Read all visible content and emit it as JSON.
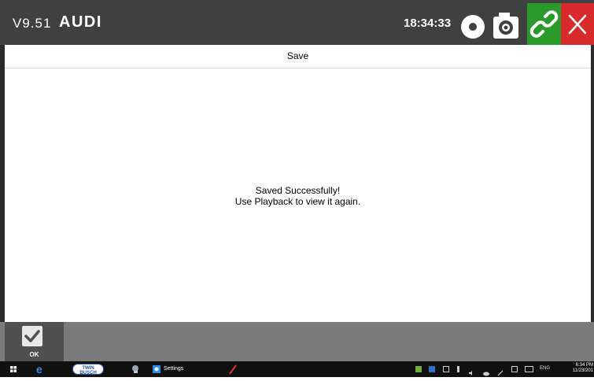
{
  "header": {
    "version": "V9.51",
    "make": "AUDI",
    "clock": "18:34:33",
    "icons": [
      "record-icon",
      "camera-icon",
      "link-icon",
      "close-icon"
    ]
  },
  "subheader": {
    "title": "Save"
  },
  "message": {
    "line1": "Saved Successfully!",
    "line2": "Use Playback to view it again."
  },
  "footer": {
    "ok_label": "OK"
  },
  "taskbar": {
    "brand_badge": "TWIN BUSCH",
    "settings_label": "Settings",
    "lang": "ENG",
    "time": "6:34 PM",
    "date": "11/23/201"
  },
  "colors": {
    "titlebar": "#404040",
    "link_button": "#2a9a2a",
    "close_button": "#d82a2a",
    "bottombar": "#7a7a7a"
  }
}
